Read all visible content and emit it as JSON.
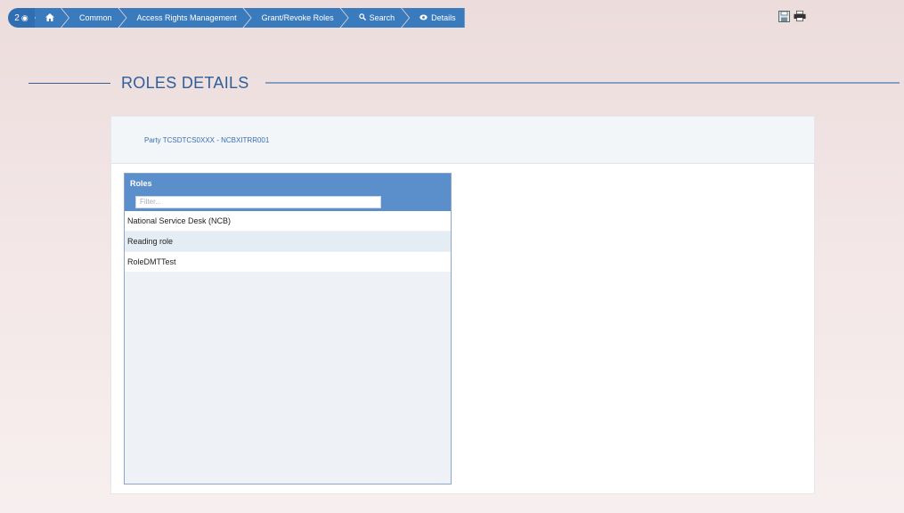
{
  "breadcrumb": {
    "badge": "2",
    "badge_icon": "eye-icon",
    "items": [
      {
        "label": "",
        "icon": "home-icon"
      },
      {
        "label": "Common"
      },
      {
        "label": "Access Rights Management"
      },
      {
        "label": "Grant/Revoke Roles"
      },
      {
        "label": "Search",
        "icon": "search-icon"
      },
      {
        "label": "Details",
        "icon": "eye-icon"
      }
    ]
  },
  "toolbar": {
    "icons": [
      "save-icon",
      "print-icon"
    ]
  },
  "page": {
    "title": "ROLES DETAILS"
  },
  "panel": {
    "header": "Party TCSDTCS0XXX - NCBXITRR001"
  },
  "roles": {
    "header": "Roles",
    "filter_placeholder": "Filter...",
    "items": [
      {
        "label": "National Service Desk (NCB)"
      },
      {
        "label": "Reading role"
      },
      {
        "label": "RoleDMTTest"
      }
    ]
  },
  "colors": {
    "accent": "#3a7bbd",
    "title": "#2f5f99",
    "list_header": "#5b8fcb"
  }
}
